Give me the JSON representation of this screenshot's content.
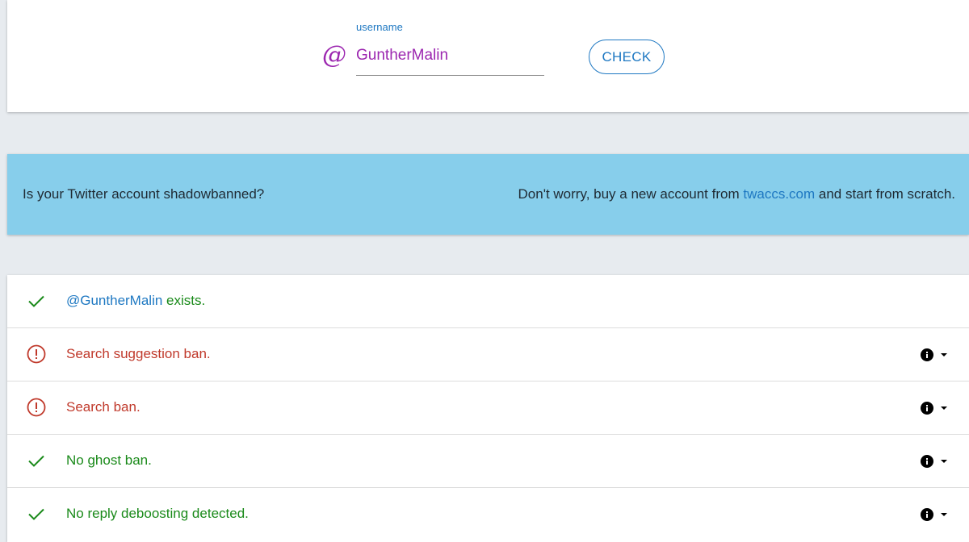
{
  "search": {
    "label": "username",
    "at_symbol": "@",
    "value": "GuntherMalin",
    "check_label": "CHECK"
  },
  "banner": {
    "question": "Is your Twitter account shadowbanned?",
    "pitch_before": "Don't worry, buy a new account from ",
    "link_text": "twaccs.com",
    "pitch_after": " and start from scratch."
  },
  "results": [
    {
      "status": "ok",
      "icon": "check-icon",
      "handle": "@GuntherMalin",
      "text": " exists."
    },
    {
      "status": "ban",
      "icon": "alert-circle-icon",
      "text": "Search suggestion ban."
    },
    {
      "status": "ban",
      "icon": "alert-circle-icon",
      "text": "Search ban."
    },
    {
      "status": "ok",
      "icon": "check-icon",
      "text": "No ghost ban."
    },
    {
      "status": "ok",
      "icon": "check-icon",
      "text": "No reply deboosting detected."
    }
  ],
  "colors": {
    "accent": "#1e78c2",
    "username": "#9c27b0",
    "banner_bg": "#87ceeb",
    "ok": "#1a8a1a",
    "ban": "#c0392b",
    "page_bg": "#e7ebef"
  }
}
